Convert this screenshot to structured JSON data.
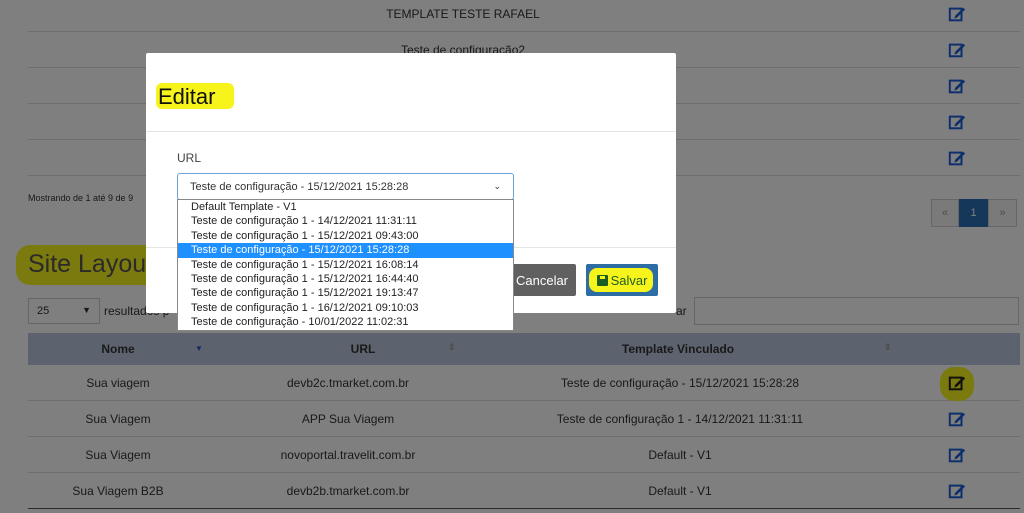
{
  "background_table": {
    "top_rows": [
      {
        "template": "TEMPLATE TESTE RAFAEL"
      },
      {
        "template": "Teste de configuração2"
      },
      {
        "template": ""
      },
      {
        "template": ""
      },
      {
        "template": ""
      }
    ],
    "info": "Mostrando de 1 até 9 de 9",
    "pagination": {
      "prev": "«",
      "current": "1",
      "next": "»"
    }
  },
  "site_layout": {
    "title": "Site Layout",
    "page_size": "25",
    "results_label": "resultados p",
    "search_label": "ar",
    "columns": [
      "Nome",
      "URL",
      "Template Vinculado"
    ],
    "rows": [
      {
        "nome": "Sua viagem",
        "url": "devb2c.tmarket.com.br",
        "template": "Teste de configuração - 15/12/2021 15:28:28"
      },
      {
        "nome": "Sua Viagem",
        "url": "APP Sua Viagem",
        "template": "Teste de configuração 1 - 14/12/2021 11:31:11"
      },
      {
        "nome": "Sua Viagem",
        "url": "novoportal.travelit.com.br",
        "template": "Default - V1"
      },
      {
        "nome": "Sua Viagem B2B",
        "url": "devb2b.tmarket.com.br",
        "template": "Default - V1"
      }
    ]
  },
  "modal": {
    "title": "Editar",
    "field_label": "URL",
    "selected_value": "Teste de configuração - 15/12/2021 15:28:28",
    "options": [
      "Default Template - V1",
      "Teste de configuração 1 - 14/12/2021 11:31:11",
      "Teste de configuração 1 - 15/12/2021 09:43:00",
      "Teste de configuração - 15/12/2021 15:28:28",
      "Teste de configuração 1 - 15/12/2021 16:08:14",
      "Teste de configuração 1 - 15/12/2021 16:44:40",
      "Teste de configuração 1 - 15/12/2021 19:13:47",
      "Teste de configuração 1 - 16/12/2021 09:10:03",
      "Teste de configuração - 10/01/2022 11:02:31"
    ],
    "selected_index": 3,
    "cancel_label": "Cancelar",
    "save_label": "Salvar"
  },
  "colors": {
    "highlight": "#f7f41c",
    "edit_icon": "#1a5fd8",
    "save_button": "#2e6da4",
    "header_bg": "#b9c6dc"
  }
}
